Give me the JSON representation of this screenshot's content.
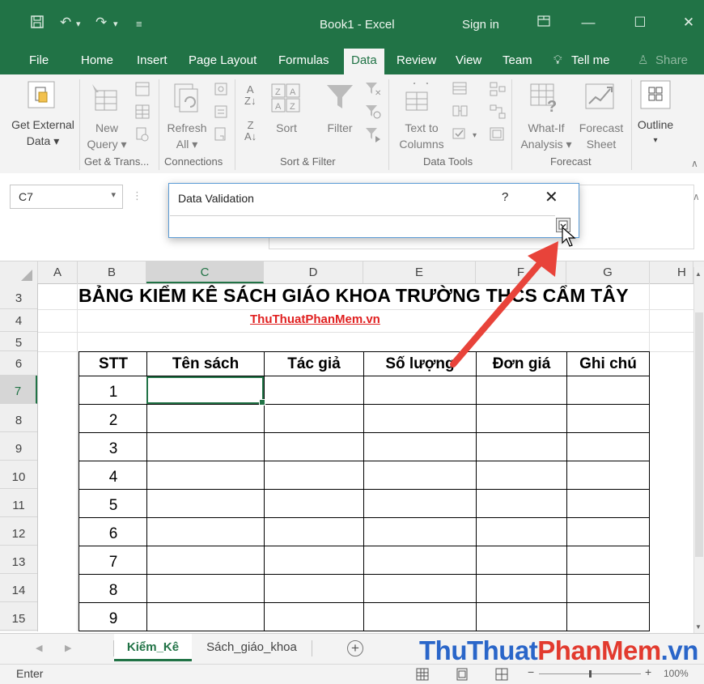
{
  "window": {
    "document_title": "Book1  -  Excel",
    "sign_in": "Sign in"
  },
  "ribbon_tabs": [
    "File",
    "Home",
    "Insert",
    "Page Layout",
    "Formulas",
    "Data",
    "Review",
    "View",
    "Team",
    "Tell me",
    "Share"
  ],
  "ribbon": {
    "get_external_data": [
      "Get External",
      "Data ▾"
    ],
    "new_query": [
      "New",
      "Query ▾"
    ],
    "refresh_all": [
      "Refresh",
      "All ▾"
    ],
    "sort": "Sort",
    "filter": "Filter",
    "text_to_columns": [
      "Text to",
      "Columns"
    ],
    "what_if": [
      "What-If",
      "Analysis ▾"
    ],
    "forecast_sheet": [
      "Forecast",
      "Sheet"
    ],
    "outline": "Outline",
    "groups": {
      "get_transform": "Get & Trans...",
      "connections": "Connections",
      "sort_filter": "Sort & Filter",
      "data_tools": "Data Tools",
      "forecast": "Forecast"
    }
  },
  "name_box": "C7",
  "dialog": {
    "title": "Data Validation",
    "help": "?",
    "close": "✕",
    "input_value": ""
  },
  "columns": [
    "A",
    "B",
    "C",
    "D",
    "E",
    "F",
    "G",
    "H"
  ],
  "rows": [
    "3",
    "4",
    "5",
    "6",
    "7",
    "8",
    "9",
    "10",
    "11",
    "12",
    "13",
    "14",
    "15"
  ],
  "sheet": {
    "title": "BẢNG KIỂM KÊ SÁCH GIÁO KHOA TRƯỜNG THCS CẨM TÂY",
    "link": "ThuThuatPhanMem.vn",
    "headers": [
      "STT",
      "Tên sách",
      "Tác giả",
      "Số lượng",
      "Đơn giá",
      "Ghi chú"
    ],
    "stt": [
      "1",
      "2",
      "3",
      "4",
      "5",
      "6",
      "7",
      "8",
      "9"
    ]
  },
  "sheet_tabs": [
    "Kiểm_Kê",
    "Sách_giáo_khoa"
  ],
  "watermark": {
    "part1": "ThuThuat",
    "part2": "PhanMem",
    "part3": ".vn"
  },
  "status": {
    "mode": "Enter",
    "zoom": "100%"
  },
  "colors": {
    "excel_green": "#217346",
    "arrow_red": "#e8433a",
    "link_red": "#e02020",
    "watermark_blue": "#2a66c9",
    "watermark_red": "#e23a2e"
  }
}
